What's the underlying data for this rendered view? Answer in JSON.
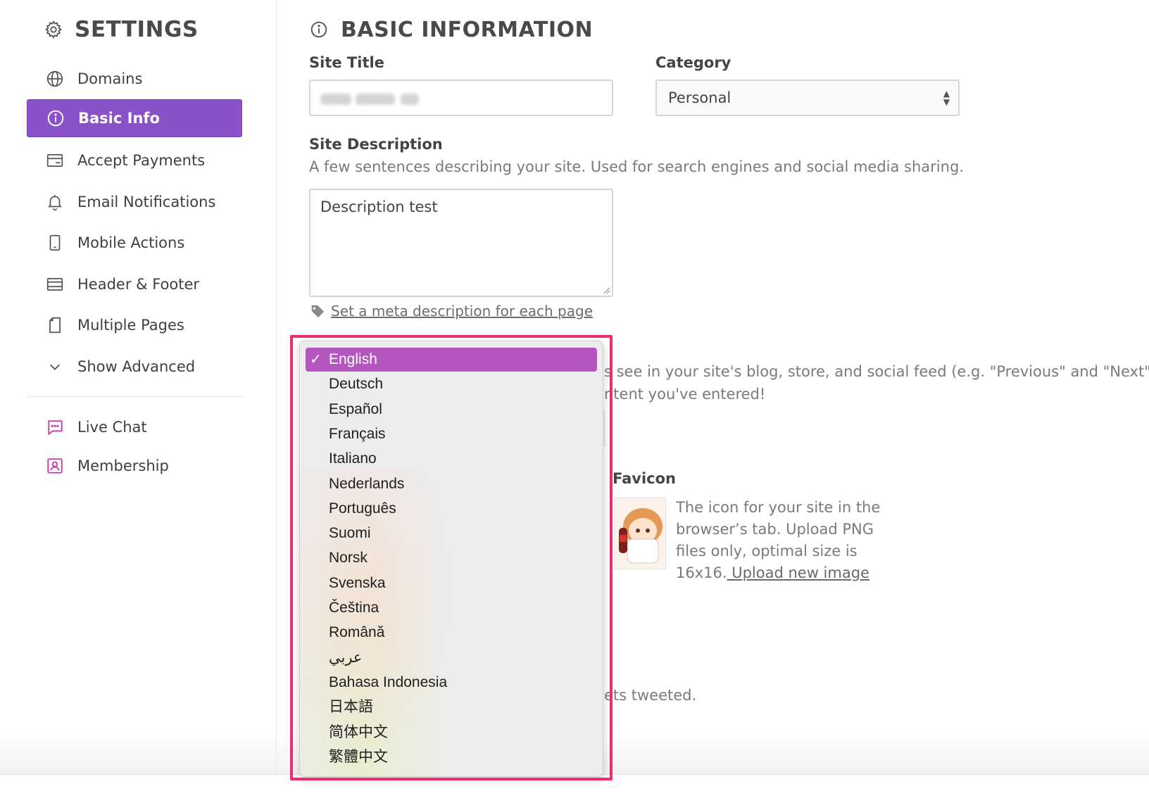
{
  "sidebar": {
    "title": "SETTINGS",
    "items": [
      {
        "label": "Domains",
        "icon": "globe-icon"
      },
      {
        "label": "Basic Info",
        "icon": "info-icon",
        "active": true
      },
      {
        "label": "Accept Payments",
        "icon": "credit-card-icon"
      },
      {
        "label": "Email Notifications",
        "icon": "bell-icon"
      },
      {
        "label": "Mobile Actions",
        "icon": "mobile-icon"
      },
      {
        "label": "Header & Footer",
        "icon": "layout-icon"
      },
      {
        "label": "Multiple Pages",
        "icon": "pages-icon"
      },
      {
        "label": "Show Advanced",
        "icon": "chevron-down-icon"
      }
    ],
    "extras": [
      {
        "label": "Live Chat",
        "icon": "chat-icon"
      },
      {
        "label": "Membership",
        "icon": "membership-icon"
      }
    ]
  },
  "main": {
    "title": "BASIC INFORMATION",
    "site_title_label": "Site Title",
    "category_label": "Category",
    "category_value": "Personal",
    "description_label": "Site Description",
    "description_help": "A few sentences describing your site. Used for search engines and social media sharing.",
    "description_value": "Description test",
    "meta_link": "Set a meta description for each page",
    "language_help_line1": "s see in your site's blog, store, and social feed (e.g. \"Previous\" and \"Next\"",
    "language_help_line2": "ntent you've entered!",
    "favicon_title": "Favicon",
    "favicon_desc": "The icon for your site in the browser’s tab. Upload PNG files only, optimal size is 16x16.",
    "favicon_link": " Upload new image",
    "tweet_partial": "ets tweeted."
  },
  "language_dropdown": {
    "selected": "English",
    "options": [
      "English",
      "Deutsch",
      "Español",
      "Français",
      "Italiano",
      "Nederlands",
      "Português",
      "Suomi",
      "Norsk",
      "Svenska",
      "Čeština",
      "Română",
      "عربي",
      "Bahasa Indonesia",
      "日本語",
      "简体中文",
      "繁體中文"
    ]
  },
  "colors": {
    "accent": "#8a52c9",
    "selected_option": "#b455c0",
    "highlight": "#ee2c73"
  }
}
